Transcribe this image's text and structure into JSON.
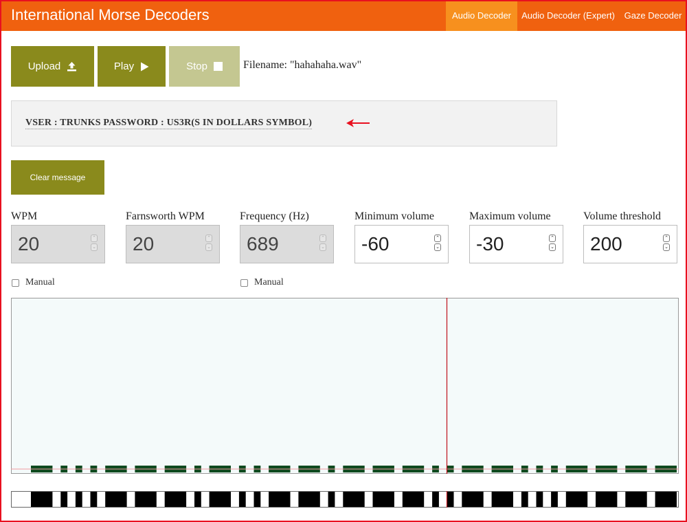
{
  "app": {
    "title": "International Morse Decoders"
  },
  "nav": {
    "items": [
      {
        "label": "Audio Decoder",
        "active": true
      },
      {
        "label": "Audio Decoder (Expert)",
        "active": false
      },
      {
        "label": "Gaze Decoder",
        "active": false
      }
    ]
  },
  "toolbar": {
    "upload_label": "Upload",
    "upload_icon": "upload-icon",
    "play_label": "Play",
    "play_icon": "play-icon",
    "stop_label": "Stop",
    "stop_icon": "stop-icon",
    "stop_enabled": false,
    "filename_text": "Filename: \"hahahaha.wav\""
  },
  "message": {
    "text": "VSER : TRUNKS PASSWORD : US3R(S IN DOLLARS SYMBOL)",
    "annotation_icon": "red-arrow-icon",
    "annotation_color": "#e8101f"
  },
  "clear_button": {
    "label": "Clear message"
  },
  "fields": [
    {
      "label": "WPM",
      "value": "20",
      "disabled": true
    },
    {
      "label": "Farnsworth WPM",
      "value": "20",
      "disabled": true
    },
    {
      "label": "Frequency (Hz)",
      "value": "689",
      "disabled": true
    },
    {
      "label": "Minimum volume",
      "value": "-60",
      "disabled": false
    },
    {
      "label": "Maximum volume",
      "value": "-30",
      "disabled": false
    },
    {
      "label": "Volume threshold",
      "value": "200",
      "disabled": false
    }
  ],
  "checkboxes": [
    {
      "label": "Manual",
      "checked": false
    },
    {
      "label": "Manual",
      "checked": false
    }
  ],
  "colors": {
    "navbar": "#f0610f",
    "nav_active": "#f7901e",
    "button": "#8a8a1c",
    "button_disabled": "#c4c791",
    "spectrogram_bg": "#f4fafa",
    "signal": "#0f4a1f",
    "cursor": "#c0101a"
  },
  "morse": {
    "pattern": "L.s.s.s.L.L.L.s.L.s.s.L.L.s.L.L.L.s.s.L.L.s.s.s.L.L.L.L"
  }
}
